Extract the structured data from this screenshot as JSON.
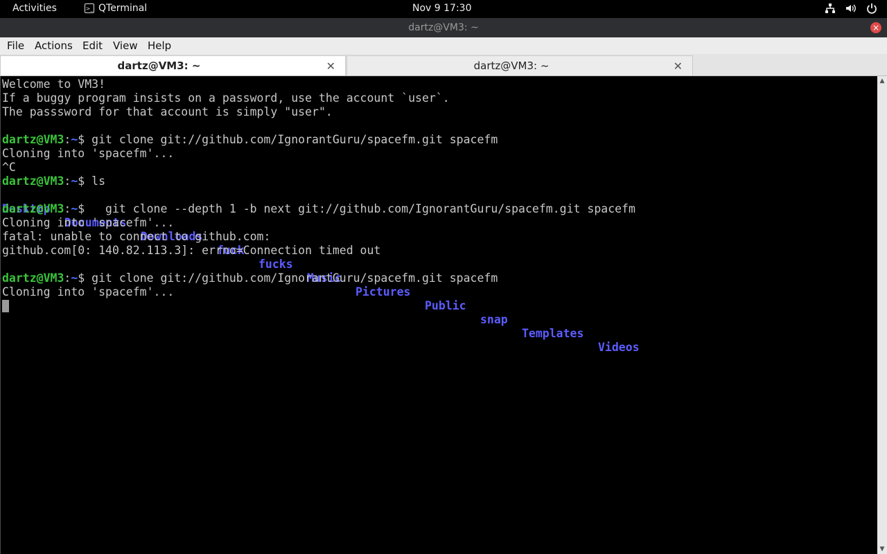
{
  "topbar": {
    "activities": "Activities",
    "app_name": "QTerminal",
    "app_icon": "terminal-icon",
    "clock": "Nov 9  17:30",
    "tray_icons": [
      "network-icon",
      "volume-icon",
      "power-icon"
    ]
  },
  "window": {
    "title": "dartz@VM3: ~",
    "close_icon": "close-icon"
  },
  "menu": {
    "items": [
      "File",
      "Actions",
      "Edit",
      "View",
      "Help"
    ]
  },
  "tabs": [
    {
      "label": "dartz@VM3: ~",
      "active": true
    },
    {
      "label": "dartz@VM3: ~",
      "active": false
    }
  ],
  "terminal": {
    "prompt_user": "dartz@VM3",
    "prompt_sep": ":",
    "prompt_path": "~",
    "prompt_end": "$",
    "lines": {
      "welcome": "Welcome to VM3!",
      "buggy": "If a buggy program insists on a password, use the account `user`.",
      "password": "The passsword for that account is simply \"user\".",
      "cmd1": " git clone git://github.com/IgnorantGuru/spacefm.git spacefm",
      "cloning1": "Cloning into 'spacefm'...",
      "ctrl_c": "^C",
      "cmd2": " ls",
      "cmd3": "   git clone --depth 1 -b next git://github.com/IgnorantGuru/spacefm.git spacefm",
      "cloning2": "Cloning into 'spacefm'...",
      "fatal": "fatal: unable to connect to github.com:",
      "errno": "github.com[0: 140.82.113.3]: errno=Connection timed out",
      "cmd4": " git clone git://github.com/IgnorantGuru/spacefm.git spacefm",
      "cloning3": "Cloning into 'spacefm'..."
    },
    "ls_output": [
      "Desktop",
      "Documents",
      "Downloads",
      "fuck",
      "fucks",
      "Music",
      "Pictures",
      "Public",
      "snap",
      "Templates",
      "Videos"
    ]
  },
  "colors": {
    "prompt_user": "#3bc43b",
    "prompt_path": "#4e6fff",
    "directory": "#5c5cff",
    "text": "#c8c8c8",
    "background": "#000000"
  }
}
